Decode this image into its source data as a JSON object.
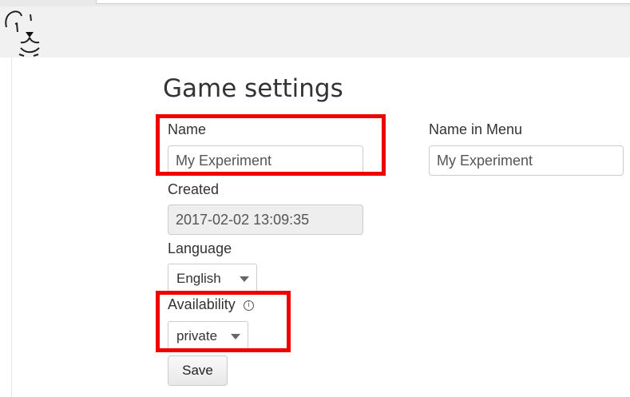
{
  "page": {
    "title": "Game settings"
  },
  "form": {
    "name": {
      "label": "Name",
      "value": "My Experiment"
    },
    "name_in_menu": {
      "label": "Name in Menu",
      "value": "My Experiment"
    },
    "created": {
      "label": "Created",
      "value": "2017-02-02 13:09:35"
    },
    "language": {
      "label": "Language",
      "selected": "English"
    },
    "availability": {
      "label": "Availability",
      "selected": "private",
      "info_icon": "info-circle-icon",
      "info_glyph": "i"
    },
    "save_label": "Save"
  },
  "colors": {
    "highlight": "#ee0000",
    "readonly_background": "#eeeeee",
    "border": "#cccccc"
  },
  "icons": {
    "logo": "bear-logo-icon",
    "dropdown": "caret-down-icon"
  }
}
